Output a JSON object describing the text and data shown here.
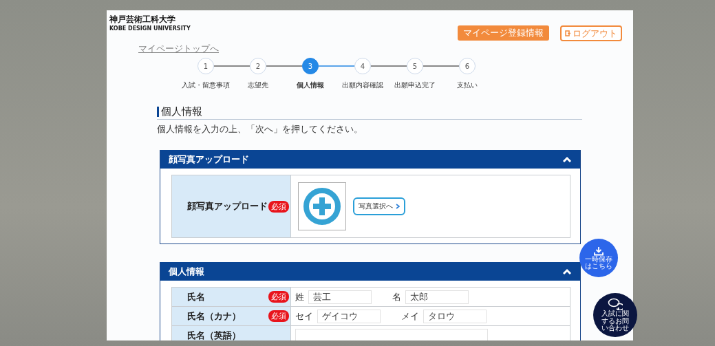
{
  "header": {
    "logo_title": "神戸芸術工科大学",
    "logo_subtitle": "KOBE DESIGN UNIVERSITY",
    "mypage_button": "マイページ登録情報",
    "logout_button": "ログアウト"
  },
  "breadcrumb_link": "マイページトップへ",
  "steps": [
    {
      "number": "1",
      "label": "入試・留意事項",
      "selected": false
    },
    {
      "number": "2",
      "label": "志望先",
      "selected": false
    },
    {
      "number": "3",
      "label": "個人情報",
      "selected": true
    },
    {
      "number": "4",
      "label": "出願内容確認",
      "selected": false
    },
    {
      "number": "5",
      "label": "出願申込完了",
      "selected": false
    },
    {
      "number": "6",
      "label": "支払い",
      "selected": false
    }
  ],
  "page_title": "個人情報",
  "instruction": "個人情報を入力の上、「次へ」を押してください。",
  "sections": [
    {
      "title": "顔写真アップロード",
      "expanded": true,
      "rows": [
        {
          "kind": "photo",
          "label": "顔写真アップロード",
          "badge": "必須",
          "button": "写真選択へ"
        }
      ]
    },
    {
      "title": "個人情報",
      "expanded": true,
      "rows": [
        {
          "kind": "pair",
          "label": "氏名",
          "badge": "必須",
          "fields": [
            {
              "label": "姓",
              "value": "芸工"
            },
            {
              "label": "名",
              "value": "太郎"
            }
          ]
        },
        {
          "kind": "pair",
          "label": "氏名（カナ）",
          "badge": "必須",
          "fields": [
            {
              "label": "セイ",
              "value": "ゲイコウ"
            },
            {
              "label": "メイ",
              "value": "タロウ"
            }
          ]
        },
        {
          "kind": "text",
          "label": "氏名（英語）"
        }
      ]
    }
  ],
  "floating": {
    "save_button": "一時保存はこちら",
    "contact_button": "入試に関するお問い合わせ"
  }
}
